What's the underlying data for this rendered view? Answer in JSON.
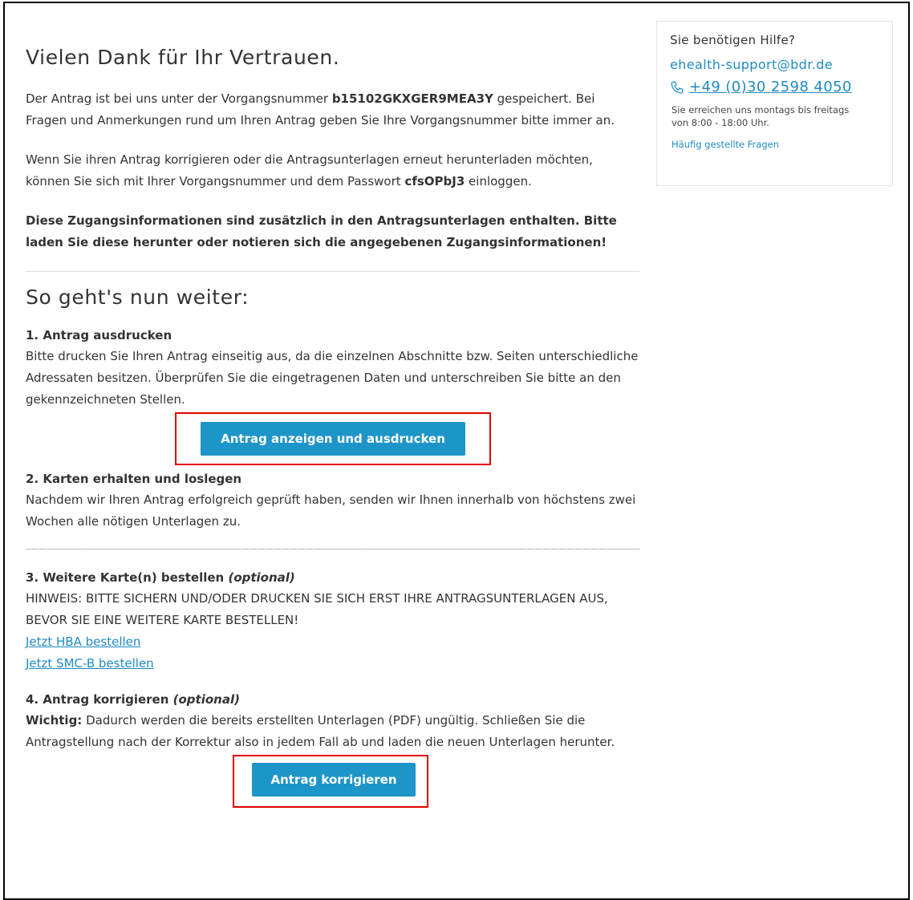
{
  "thanks": {
    "title": "Vielen Dank für Ihr Vertrauen.",
    "p1_before": "Der Antrag ist bei uns unter der Vorgangsnummer ",
    "case_number": "b15102GKXGER9MEA3Y",
    "p1_after": " gespeichert. Bei Fragen und Anmerkungen rund um Ihren Antrag geben Sie Ihre Vorgangsnummer bitte immer an.",
    "p2_before": "Wenn Sie ihren Antrag korrigieren oder die Antragsunterlagen erneut herunterladen möchten, können Sie sich mit Ihrer Vorgangsnummer und dem Passwort ",
    "password": "cfsOPbJ3",
    "p2_after": " einloggen.",
    "p3_bold": "Diese Zugangsinformationen sind zusätzlich in den Antragsunterlagen enthalten. Bitte laden Sie diese herunter oder notieren sich die angegebenen Zugangsinformationen!"
  },
  "next": {
    "title": "So geht's nun weiter:",
    "step1": {
      "title": "1. Antrag ausdrucken",
      "text": "Bitte drucken Sie Ihren Antrag einseitig aus, da die einzelnen Abschnitte bzw. Seiten unterschiedliche Adressaten besitzen. Überprüfen Sie die eingetragenen Daten und unterschreiben Sie bitte an den gekennzeichneten Stellen.",
      "button": "Antrag anzeigen und ausdrucken"
    },
    "step2": {
      "title": "2. Karten erhalten und loslegen",
      "text": "Nachdem wir Ihren Antrag erfolgreich geprüft haben, senden wir Ihnen innerhalb von höchstens zwei Wochen alle nötigen Unterlagen zu."
    },
    "step3": {
      "title": "3. Weitere Karte(n) bestellen ",
      "optional": "(optional)",
      "hint": "HINWEIS: BITTE SICHERN UND/ODER DRUCKEN SIE SICH ERST IHRE ANTRAGSUNTERLAGEN AUS, BEVOR SIE EINE WEITERE KARTE BESTELLEN!",
      "link_hba": "Jetzt HBA bestellen",
      "link_smcb": "Jetzt SMC-B bestellen"
    },
    "step4": {
      "title": "4. Antrag korrigieren ",
      "optional": "(optional)",
      "important_label": "Wichtig:",
      "text": " Dadurch werden die bereits erstellten Unterlagen (PDF) ungültig. Schließen Sie die Antragstellung nach der Korrektur also in jedem Fall ab und laden die neuen Unterlagen herunter.",
      "button": "Antrag korrigieren"
    }
  },
  "help": {
    "title": "Sie benötigen Hilfe?",
    "email": "ehealth-support@bdr.de",
    "phone": "+49 (0)30 2598 4050",
    "hours": "Sie erreichen uns montags bis freitags von 8:00 - 18:00 Uhr.",
    "faq": "Häufig gestellte Fragen"
  },
  "colors": {
    "accent": "#1e95c8",
    "link": "#1e8bc3",
    "highlight": "#e10000"
  }
}
